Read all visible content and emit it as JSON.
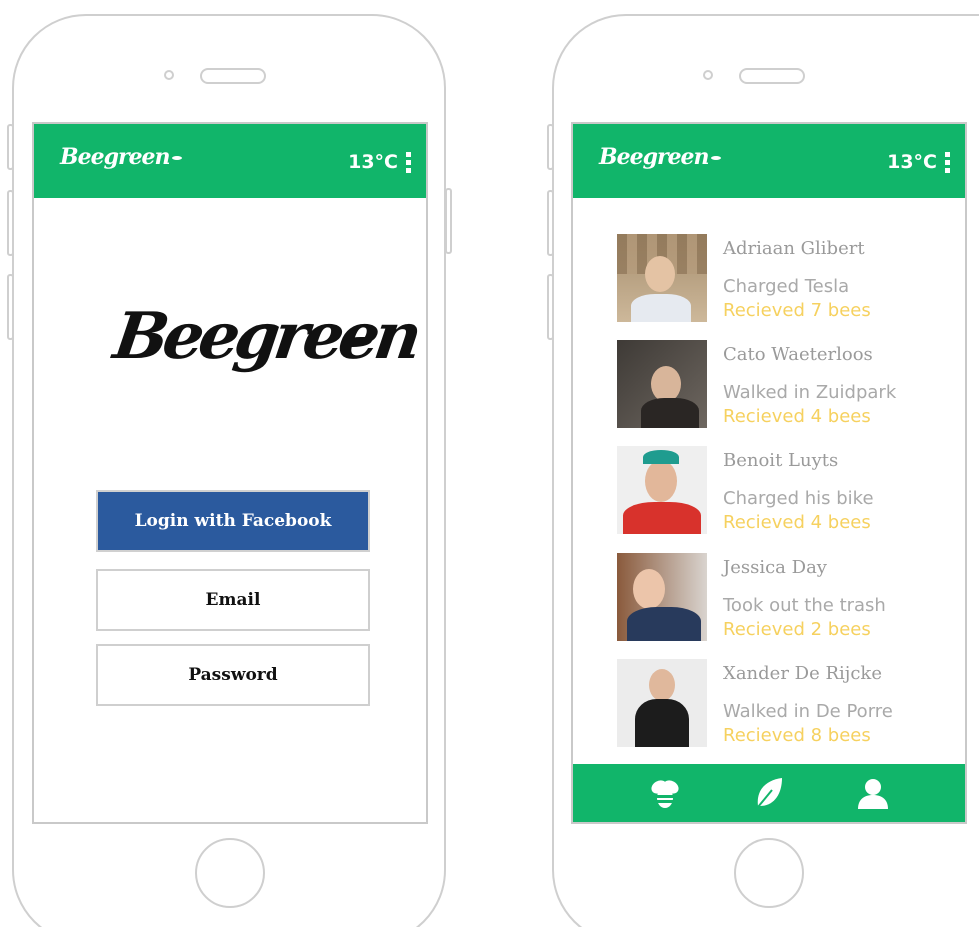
{
  "brand": {
    "app_name": "Beegreen",
    "accent": "#11b56a",
    "facebook_color": "#2b5a9e",
    "reward_color": "#f6d15f"
  },
  "login_screen": {
    "appbar": {
      "logo": "Beegreen",
      "temperature": "13°C",
      "menu_icon": "kebab-icon"
    },
    "logo": "Beegreen",
    "buttons": {
      "facebook": "Login with Facebook",
      "email": "Email",
      "password": "Password"
    }
  },
  "feed_screen": {
    "appbar": {
      "logo": "Beegreen",
      "temperature": "13°C",
      "menu_icon": "kebab-icon"
    },
    "items": [
      {
        "name": "Adriaan Glibert",
        "action": "Charged Tesla",
        "reward": "Recieved 7 bees"
      },
      {
        "name": "Cato Waeterloos",
        "action": "Walked in Zuidpark",
        "reward": "Recieved 4 bees"
      },
      {
        "name": "Benoit Luyts",
        "action": "Charged his bike",
        "reward": "Recieved 4 bees"
      },
      {
        "name": "Jessica Day",
        "action": "Took out the trash",
        "reward": "Recieved 2 bees"
      },
      {
        "name": "Xander De Rijcke",
        "action": "Walked in De Porre",
        "reward": "Recieved 8 bees"
      }
    ],
    "bottom_nav": [
      {
        "icon": "bee-icon"
      },
      {
        "icon": "leaf-icon"
      },
      {
        "icon": "user-icon"
      }
    ]
  }
}
